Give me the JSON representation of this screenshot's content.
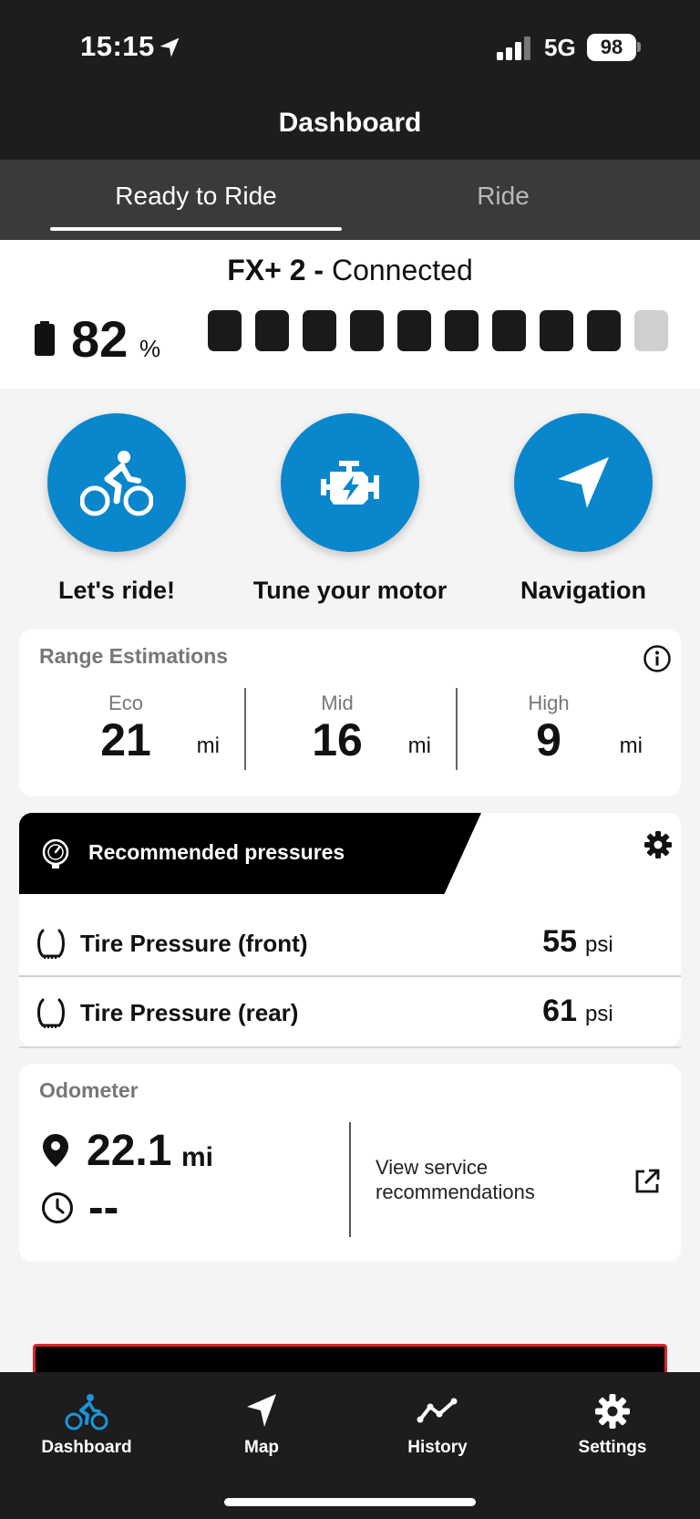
{
  "status_bar": {
    "time": "15:15",
    "network": "5G",
    "battery": "98"
  },
  "header": {
    "title": "Dashboard"
  },
  "tabs": [
    {
      "label": "Ready to Ride",
      "active": true
    },
    {
      "label": "Ride",
      "active": false
    }
  ],
  "bike": {
    "name": "FX+ 2 -",
    "status": "Connected",
    "battery_percent": "82",
    "battery_unit": "%",
    "battery_segments_filled": 9,
    "battery_segments_total": 10
  },
  "actions": [
    {
      "label": "Let's ride!",
      "icon": "cyclist-icon"
    },
    {
      "label": "Tune your motor",
      "icon": "engine-icon"
    },
    {
      "label": "Navigation",
      "icon": "navigation-arrow-icon"
    }
  ],
  "range": {
    "title": "Range Estimations",
    "modes": [
      {
        "label": "Eco",
        "value": "21",
        "unit": "mi"
      },
      {
        "label": "Mid",
        "value": "16",
        "unit": "mi"
      },
      {
        "label": "High",
        "value": "9",
        "unit": "mi"
      }
    ]
  },
  "pressures": {
    "title": "Recommended pressures",
    "rows": [
      {
        "label": "Tire Pressure (front)",
        "value": "55",
        "unit": "psi"
      },
      {
        "label": "Tire Pressure (rear)",
        "value": "61",
        "unit": "psi"
      }
    ]
  },
  "odometer": {
    "title": "Odometer",
    "distance": "22.1",
    "unit": "mi",
    "time": "--",
    "service_link": "View service recommendations"
  },
  "bottom_nav": [
    {
      "label": "Dashboard",
      "icon": "bike-icon",
      "active": true
    },
    {
      "label": "Map",
      "icon": "map-arrow-icon",
      "active": false
    },
    {
      "label": "History",
      "icon": "history-chart-icon",
      "active": false
    },
    {
      "label": "Settings",
      "icon": "settings-gear-icon",
      "active": false
    }
  ],
  "colors": {
    "accent": "#0a86cc",
    "dark": "#1d1d1d",
    "alert": "#d9262c"
  }
}
